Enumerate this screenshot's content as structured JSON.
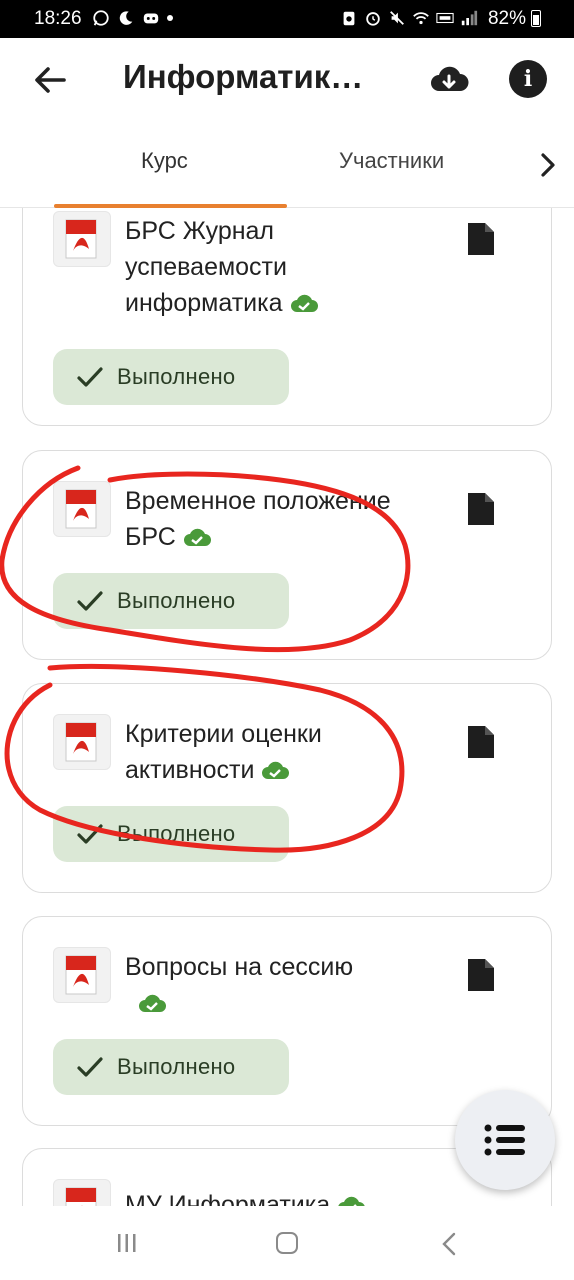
{
  "status_bar": {
    "time": "18:26",
    "battery": "82%"
  },
  "app_bar": {
    "title": "Информатик…"
  },
  "tabs": [
    {
      "label": "Курс",
      "selected": true
    },
    {
      "label": "Участники",
      "selected": false
    }
  ],
  "accent_color": "#e8802f",
  "completed_color": "#4a9a3a",
  "items": [
    {
      "title": "БРС Журнал успеваемости информатика",
      "status": "Выполнено"
    },
    {
      "title": "Временное положение БРС",
      "status": "Выполнено"
    },
    {
      "title": "Критерии оценки активности",
      "status": "Выполнено"
    },
    {
      "title": "Вопросы на сессию",
      "status": "Выполнено"
    },
    {
      "title": "МУ Информатика",
      "status": ""
    }
  ],
  "icons": {
    "back": "arrow-left-icon",
    "download": "cloud-download-icon",
    "info": "info-icon",
    "tab_next": "chevron-right-icon",
    "item_thumb": "pdf-icon",
    "item_doc": "document-icon",
    "item_synced": "cloud-check-icon",
    "status": "check-icon",
    "fab": "list-icon"
  }
}
